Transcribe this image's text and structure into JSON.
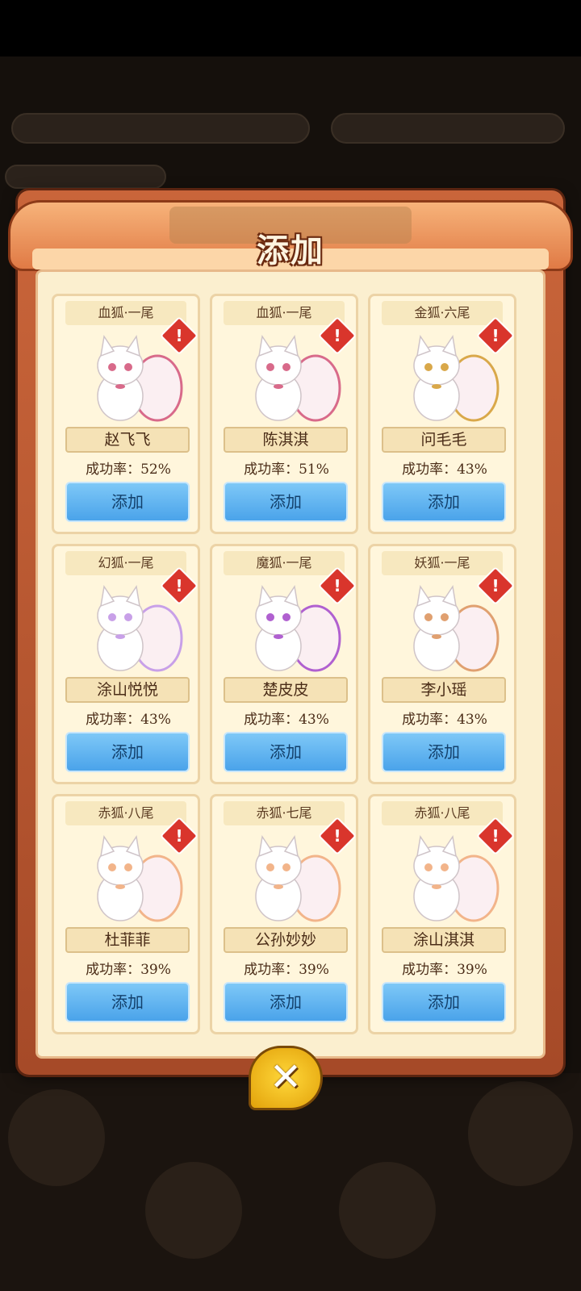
{
  "modal": {
    "title": "添加",
    "close_icon": "close-x-icon"
  },
  "cards": [
    {
      "tier": "血狐·一尾",
      "name": "赵飞飞",
      "rate": "成功率：52%",
      "button": "添加",
      "accent": "#d86a8a"
    },
    {
      "tier": "血狐·一尾",
      "name": "陈淇淇",
      "rate": "成功率：51%",
      "button": "添加",
      "accent": "#d86a8a"
    },
    {
      "tier": "金狐·六尾",
      "name": "问毛毛",
      "rate": "成功率：43%",
      "button": "添加",
      "accent": "#d9a84a"
    },
    {
      "tier": "幻狐·一尾",
      "name": "涂山悦悦",
      "rate": "成功率：43%",
      "button": "添加",
      "accent": "#c8a0e8"
    },
    {
      "tier": "魔狐·一尾",
      "name": "楚皮皮",
      "rate": "成功率：43%",
      "button": "添加",
      "accent": "#b060d0"
    },
    {
      "tier": "妖狐·一尾",
      "name": "李小瑶",
      "rate": "成功率：43%",
      "button": "添加",
      "accent": "#e0a070"
    },
    {
      "tier": "赤狐·八尾",
      "name": "杜菲菲",
      "rate": "成功率：39%",
      "button": "添加",
      "accent": "#f2b48a"
    },
    {
      "tier": "赤狐·七尾",
      "name": "公孙妙妙",
      "rate": "成功率：39%",
      "button": "添加",
      "accent": "#f2b48a"
    },
    {
      "tier": "赤狐·八尾",
      "name": "涂山淇淇",
      "rate": "成功率：39%",
      "button": "添加",
      "accent": "#f2b48a"
    }
  ],
  "colors": {
    "frame": "#c9653a",
    "card_bg": "#fff6dc",
    "button": "#4aa3ea",
    "alert": "#d9352c"
  }
}
